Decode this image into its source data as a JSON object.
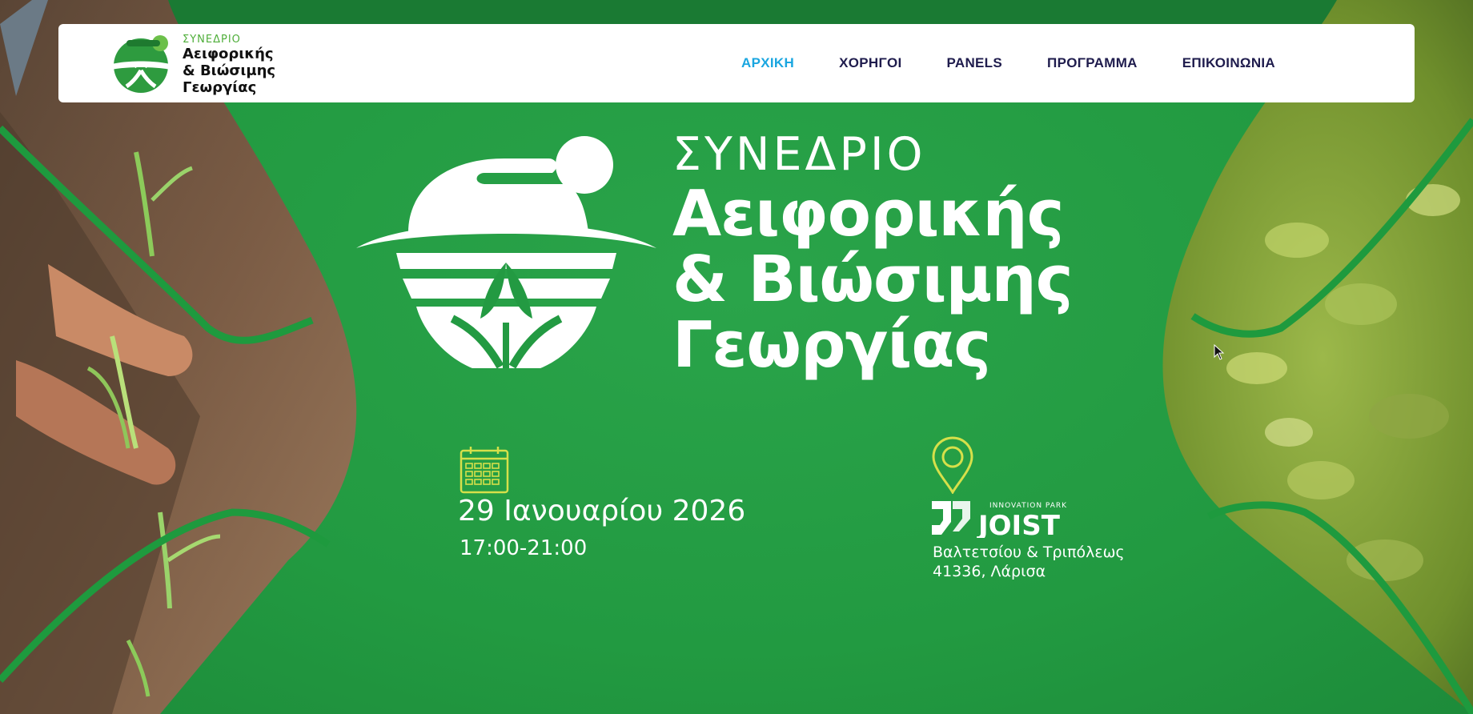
{
  "brand": {
    "small": "ΣΥΝΕΔΡΙΟ",
    "line1": "Αειφορικής",
    "line2": "& Βιώσιμης",
    "line3": "Γεωργίας"
  },
  "nav": {
    "items": [
      {
        "label": "ΑΡΧΙΚΗ",
        "active": true
      },
      {
        "label": "ΧΟΡΗΓΟΙ",
        "active": false
      },
      {
        "label": "PANELS",
        "active": false
      },
      {
        "label": "ΠΡΟΓΡΑΜΜΑ",
        "active": false
      },
      {
        "label": "ΕΠΙΚΟΙΝΩΝΙΑ",
        "active": false
      }
    ]
  },
  "hero": {
    "title_small": "ΣΥΝΕΔΡΙΟ",
    "title_line1": "Αειφορικής",
    "title_line2": "& Βιώσιμης",
    "title_line3": "Γεωργίας",
    "date": "29 Ιανουαρίου 2026",
    "time": "17:00-21:00",
    "venue_tagline": "INNOVATION PARK",
    "venue_name": "JOIST",
    "address_line1": "Βαλτετσίου & Τριπόλεως",
    "address_line2": "41336, Λάρισα"
  },
  "colors": {
    "hero_green": "#239a42",
    "nav_text": "#1f1c4d",
    "nav_active": "#1aa6e0",
    "accent_yellow": "#d6e04a"
  },
  "icons": {
    "calendar": "calendar-icon",
    "location": "location-pin-icon"
  }
}
